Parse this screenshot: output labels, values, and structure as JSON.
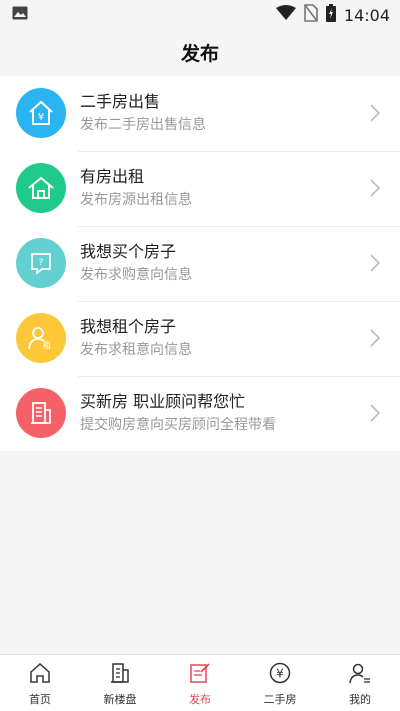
{
  "status_bar": {
    "time": "14:04"
  },
  "header": {
    "title": "发布"
  },
  "items": [
    {
      "title": "二手房出售",
      "subtitle": "发布二手房出售信息",
      "icon": "house-yuan-icon",
      "color": "#2ab4f0"
    },
    {
      "title": "有房出租",
      "subtitle": "发布房源出租信息",
      "icon": "house-icon",
      "color": "#20c98c"
    },
    {
      "title": "我想买个房子",
      "subtitle": "发布求购意向信息",
      "icon": "question-bubble-icon",
      "color": "#62cfd0"
    },
    {
      "title": "我想租个房子",
      "subtitle": "发布求租意向信息",
      "icon": "person-rent-icon",
      "color": "#fdc73a"
    },
    {
      "title": "买新房 职业顾问帮您忙",
      "subtitle": "提交购房意向买房顾问全程带看",
      "icon": "building-icon",
      "color": "#f46268"
    }
  ],
  "tabs": [
    {
      "label": "首页",
      "icon": "home-icon"
    },
    {
      "label": "新楼盘",
      "icon": "building-icon"
    },
    {
      "label": "发布",
      "icon": "edit-icon",
      "active": true
    },
    {
      "label": "二手房",
      "icon": "yuan-icon"
    },
    {
      "label": "我的",
      "icon": "user-icon"
    }
  ],
  "colors": {
    "active": "#e8474f",
    "inactive": "#333333"
  },
  "icons": {
    "status_left": "image-icon",
    "wifi": "wifi-icon",
    "signal": "no-sim-icon",
    "battery": "battery-icon"
  }
}
